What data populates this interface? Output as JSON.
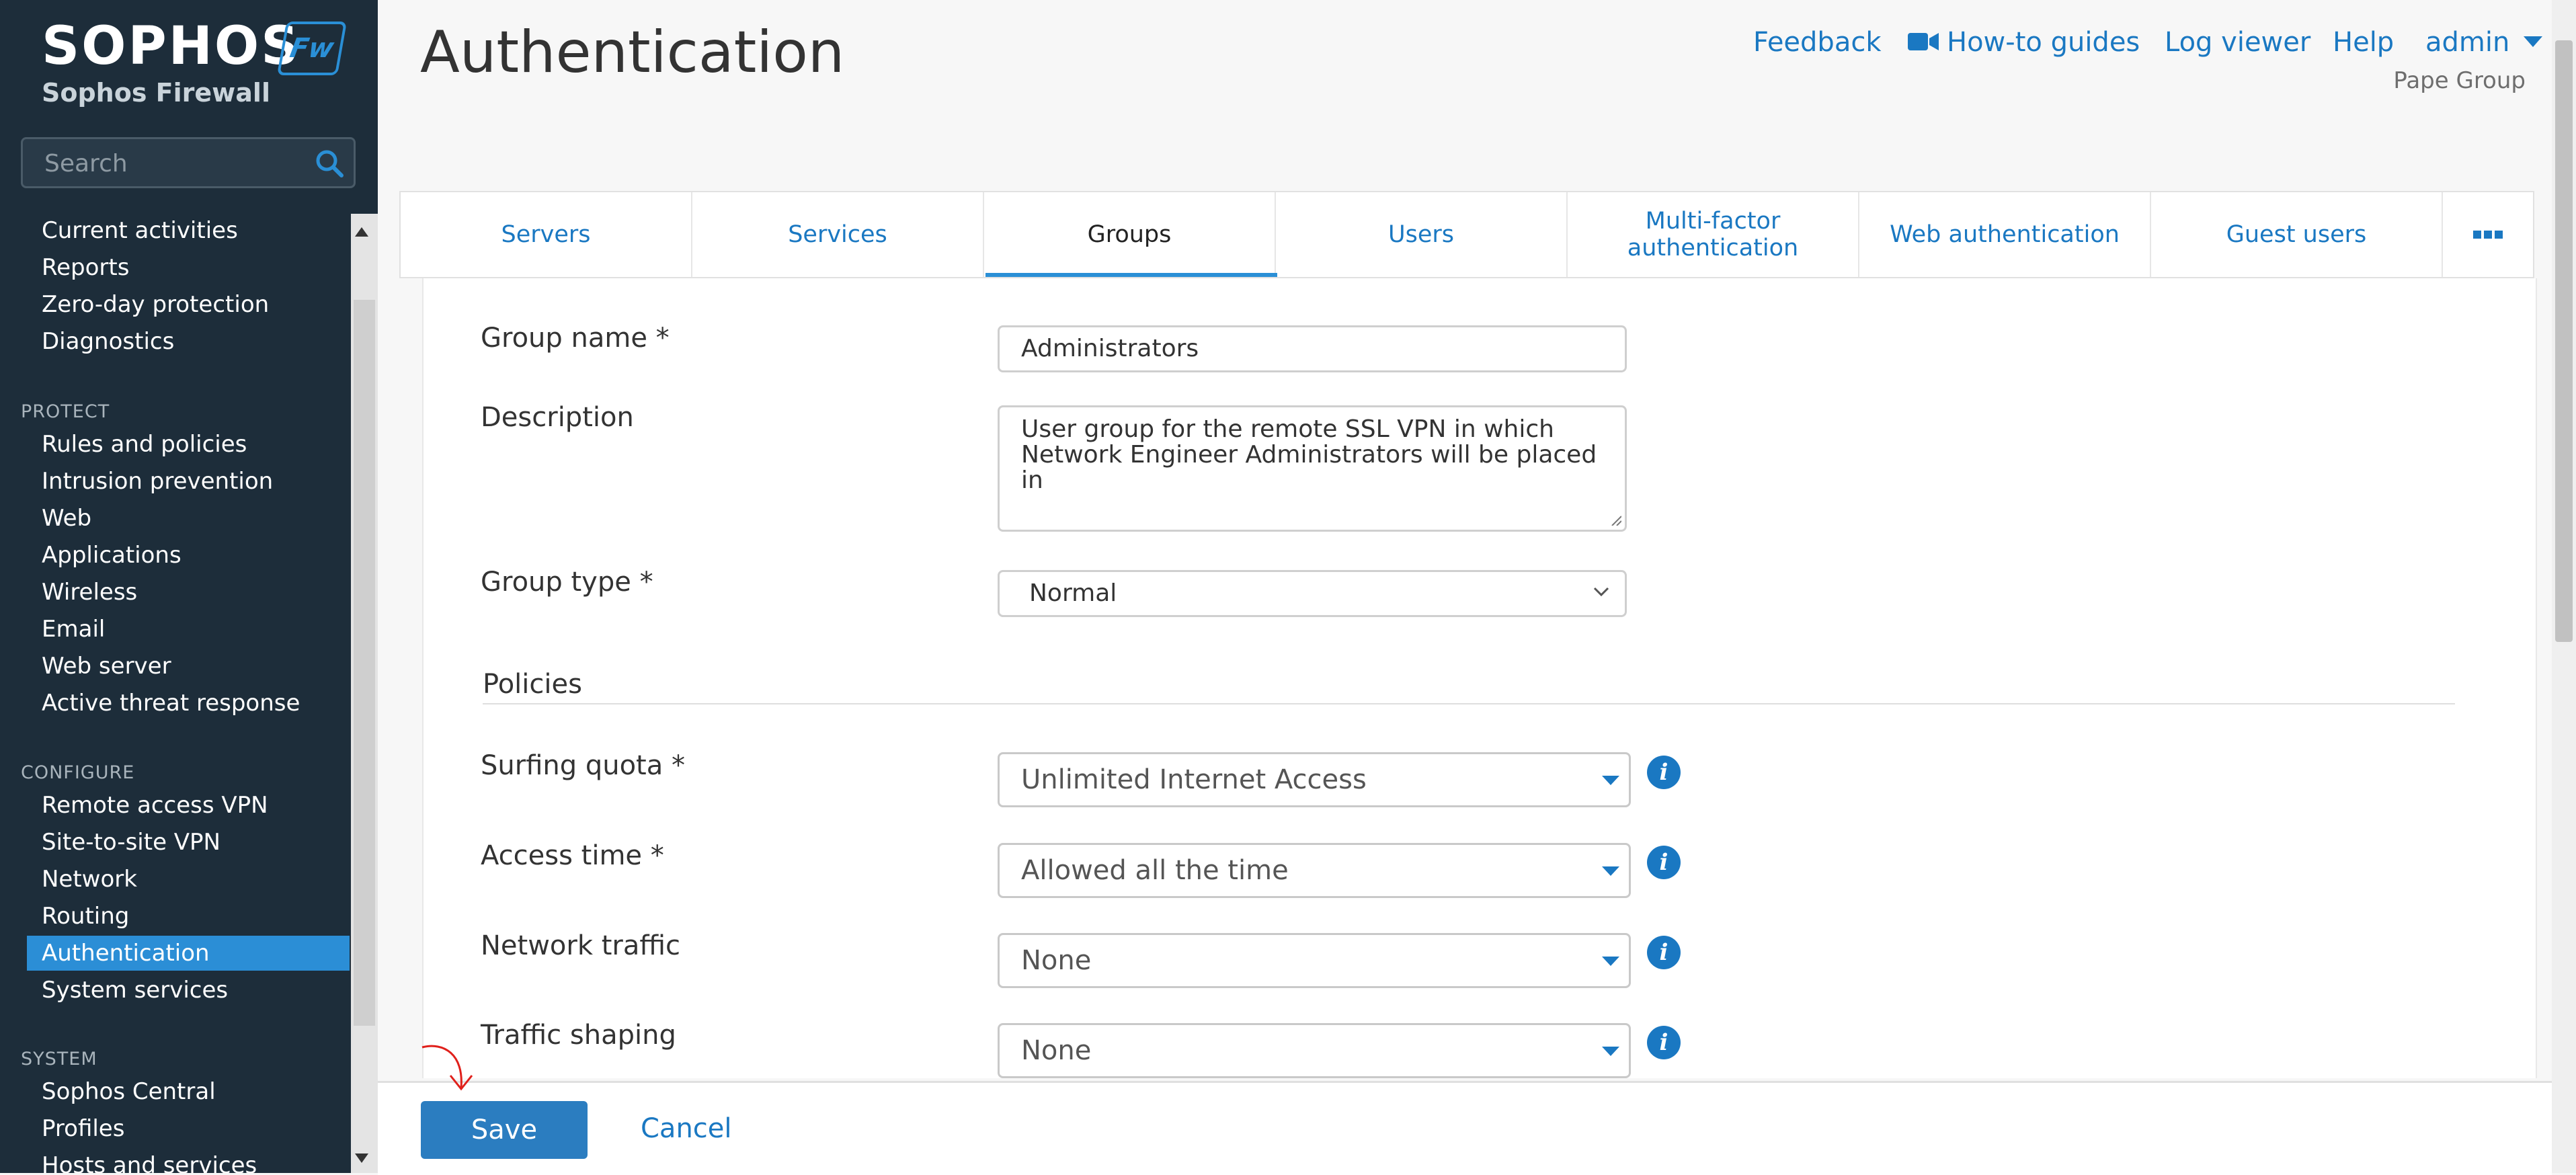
{
  "sidebar": {
    "brand": "SOPHOS",
    "badge": "Fw",
    "product": "Sophos Firewall",
    "search_placeholder": "Search",
    "monitor_items": [
      "Current activities",
      "Reports",
      "Zero-day protection",
      "Diagnostics"
    ],
    "protect_header": "PROTECT",
    "protect_items": [
      "Rules and policies",
      "Intrusion prevention",
      "Web",
      "Applications",
      "Wireless",
      "Email",
      "Web server",
      "Active threat response"
    ],
    "configure_header": "CONFIGURE",
    "configure_items": [
      "Remote access VPN",
      "Site-to-site VPN",
      "Network",
      "Routing",
      "Authentication",
      "System services"
    ],
    "system_header": "SYSTEM",
    "system_items": [
      "Sophos Central",
      "Profiles",
      "Hosts and services"
    ],
    "active_item": "Authentication"
  },
  "header": {
    "title": "Authentication",
    "links": {
      "feedback": "Feedback",
      "howto": "How-to guides",
      "logviewer": "Log viewer",
      "help": "Help",
      "admin": "admin"
    },
    "org": "Pape Group"
  },
  "tabs": [
    {
      "label": "Servers",
      "active": false
    },
    {
      "label": "Services",
      "active": false
    },
    {
      "label": "Groups",
      "active": true
    },
    {
      "label": "Users",
      "active": false
    },
    {
      "label": "Multi-factor authentication",
      "active": false
    },
    {
      "label": "Web authentication",
      "active": false
    },
    {
      "label": "Guest users",
      "active": false
    }
  ],
  "form": {
    "group_name_label": "Group name *",
    "group_name_value": "Administrators",
    "description_label": "Description",
    "description_value": "User group for the remote SSL VPN in which Network Engineer Administrators will be placed in",
    "group_type_label": "Group type *",
    "group_type_value": "Normal",
    "policies_heading": "Policies",
    "surfing_quota_label": "Surfing quota *",
    "surfing_quota_value": "Unlimited Internet Access",
    "access_time_label": "Access time *",
    "access_time_value": "Allowed all the time",
    "network_traffic_label": "Network traffic",
    "network_traffic_value": "None",
    "traffic_shaping_label": "Traffic shaping",
    "traffic_shaping_value": "None"
  },
  "footer": {
    "save": "Save",
    "cancel": "Cancel"
  },
  "colors": {
    "accent": "#1a78c2",
    "sidebar_bg": "#1d2d3a",
    "active_bg": "#2b8ed6",
    "annotation": "#e0201b"
  },
  "icons": [
    "search-icon",
    "video-camera-icon",
    "caret-down-icon",
    "more-options-icon",
    "info-icon",
    "chevron-down-icon",
    "resize-handle-icon",
    "annotation-arrow-icon"
  ]
}
